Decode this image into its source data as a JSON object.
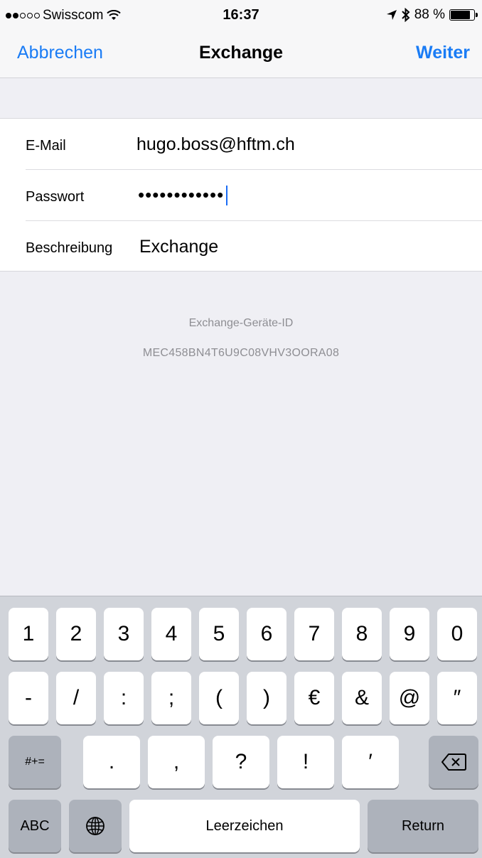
{
  "status_bar": {
    "carrier": "Swisscom",
    "time": "16:37",
    "battery": "88 %",
    "battery_level": 0.88
  },
  "nav": {
    "cancel": "Abbrechen",
    "title": "Exchange",
    "next": "Weiter"
  },
  "form": {
    "email_label": "E-Mail",
    "email_value": "hugo.boss@hftm.ch",
    "password_label": "Passwort",
    "password_value": "••••••••••••",
    "description_label": "Beschreibung",
    "description_value": "Exchange"
  },
  "device": {
    "label": "Exchange-Geräte-ID",
    "value": "MEC458BN4T6U9C08VHV3OORA08"
  },
  "keyboard": {
    "row1": [
      "1",
      "2",
      "3",
      "4",
      "5",
      "6",
      "7",
      "8",
      "9",
      "0"
    ],
    "row2": [
      "-",
      "/",
      ":",
      ";",
      "(",
      ")",
      "€",
      "&",
      "@",
      "″"
    ],
    "row3_switch": "#+=",
    "row3": [
      ".",
      ",",
      "?",
      "!",
      "′"
    ],
    "abc": "ABC",
    "space": "Leerzeichen",
    "return": "Return"
  },
  "icons": {
    "wifi": "wifi-icon",
    "location": "location-arrow-icon",
    "bluetooth": "bluetooth-icon",
    "battery": "battery-icon",
    "globe": "globe-icon",
    "backspace": "backspace-icon"
  }
}
